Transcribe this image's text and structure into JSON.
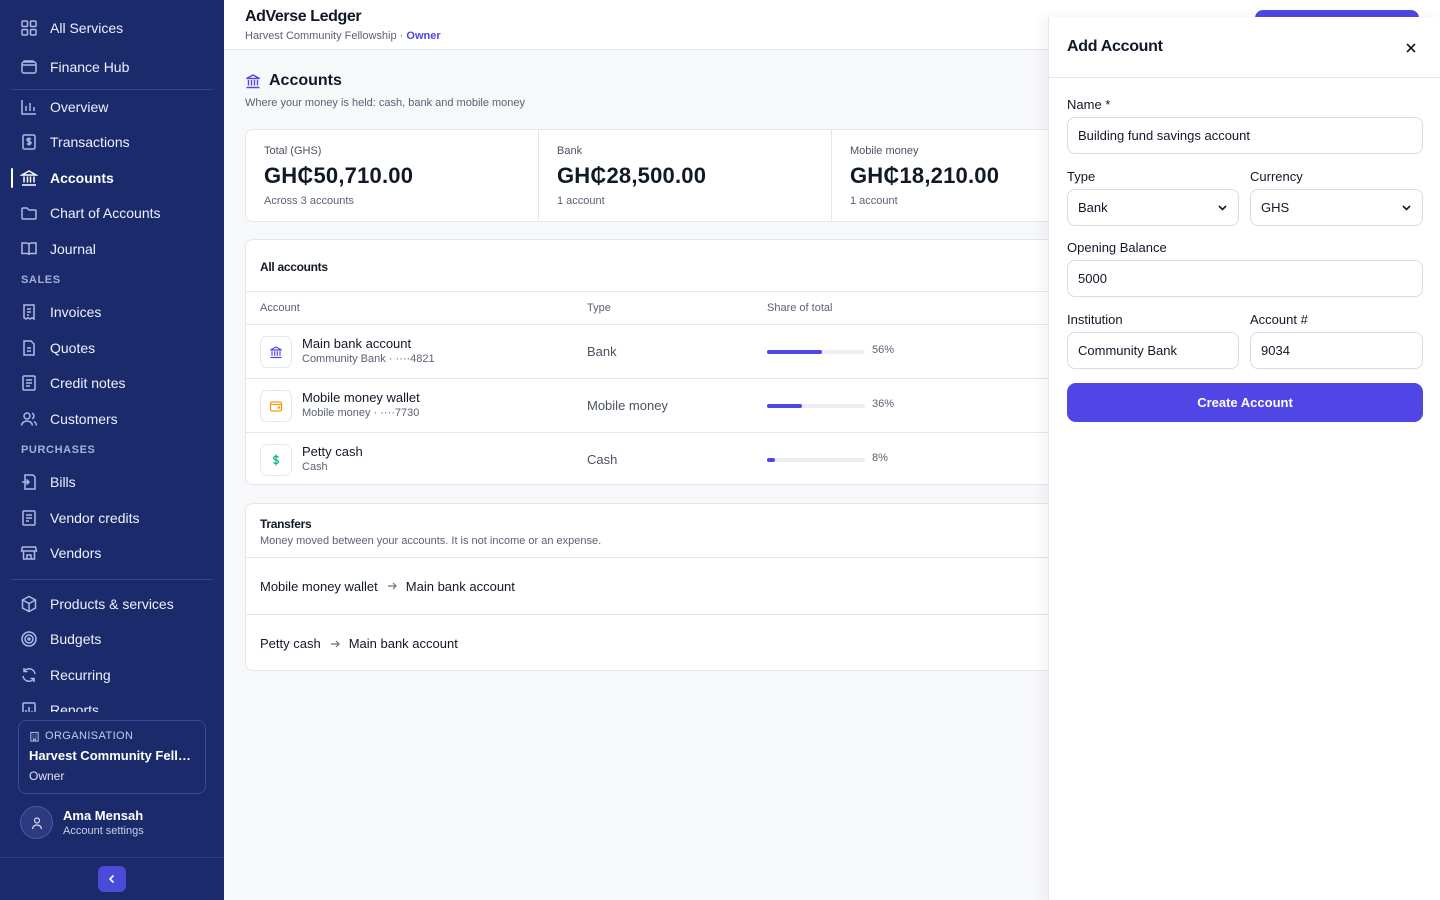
{
  "sidebar": {
    "top_items": [
      {
        "label": "All Services",
        "icon": "grid-icon"
      },
      {
        "label": "Finance Hub",
        "icon": "wallet-icon"
      }
    ],
    "main_items": [
      {
        "label": "Overview",
        "icon": "bar-chart-icon"
      },
      {
        "label": "Transactions",
        "icon": "dollar-doc-icon"
      },
      {
        "label": "Accounts",
        "icon": "bank-icon",
        "active": true
      },
      {
        "label": "Chart of Accounts",
        "icon": "folder-icon"
      },
      {
        "label": "Journal",
        "icon": "book-icon"
      }
    ],
    "sales_title": "SALES",
    "sales_items": [
      {
        "label": "Invoices",
        "icon": "receipt-icon"
      },
      {
        "label": "Quotes",
        "icon": "document-icon"
      },
      {
        "label": "Credit notes",
        "icon": "note-icon"
      },
      {
        "label": "Customers",
        "icon": "users-icon"
      }
    ],
    "purchases_title": "PURCHASES",
    "purchases_items": [
      {
        "label": "Bills",
        "icon": "bill-icon"
      },
      {
        "label": "Vendor credits",
        "icon": "credit-doc-icon"
      },
      {
        "label": "Vendors",
        "icon": "store-icon"
      }
    ],
    "other_items": [
      {
        "label": "Products & services",
        "icon": "box-icon"
      },
      {
        "label": "Budgets",
        "icon": "target-icon"
      },
      {
        "label": "Recurring",
        "icon": "refresh-icon"
      },
      {
        "label": "Reports",
        "icon": "report-icon"
      }
    ],
    "org": {
      "label": "ORGANISATION",
      "name": "Harvest Community Fello...",
      "role": "Owner"
    },
    "user": {
      "name": "Ama Mensah",
      "sub": "Account settings"
    },
    "colors": {
      "background": "#1b2a6b",
      "accent": "#4a4bd8"
    }
  },
  "header": {
    "title": "AdVerse Ledger",
    "org": "Harvest Community Fellowship",
    "separator": " · ",
    "role": "Owner"
  },
  "page": {
    "title": "Accounts",
    "subtitle": "Where your money is held: cash, bank and mobile money"
  },
  "stats": [
    {
      "label": "Total (GHS)",
      "value": "GH₵50,710.00",
      "note": "Across 3 accounts"
    },
    {
      "label": "Bank",
      "value": "GH₵28,500.00",
      "note": "1 account"
    },
    {
      "label": "Mobile money",
      "value": "GH₵18,210.00",
      "note": "1 account"
    }
  ],
  "accounts_table": {
    "title": "All accounts",
    "columns": [
      "Account",
      "Type",
      "Share of total"
    ],
    "rows": [
      {
        "name": "Main bank account",
        "meta": "Community Bank · ····4821",
        "type": "Bank",
        "share": 0.56,
        "share_label": "56%",
        "icon": "bank-icon",
        "icon_color": "#4f46e5"
      },
      {
        "name": "Mobile money wallet",
        "meta": "Mobile money · ····7730",
        "type": "Mobile money",
        "share": 0.36,
        "share_label": "36%",
        "icon": "wallet-icon",
        "icon_color": "#f59e0b"
      },
      {
        "name": "Petty cash",
        "meta": "Cash",
        "type": "Cash",
        "share": 0.08,
        "share_label": "8%",
        "icon": "dollar-icon",
        "icon_color": "#10b981"
      }
    ]
  },
  "transfers": {
    "title": "Transfers",
    "subtitle": "Money moved between your accounts. It is not income or an expense.",
    "rows": [
      {
        "from": "Mobile money wallet",
        "to": "Main bank account"
      },
      {
        "from": "Petty cash",
        "to": "Main bank account"
      }
    ]
  },
  "drawer": {
    "title": "Add Account",
    "name_label": "Name *",
    "name_value": "Building fund savings account",
    "type_label": "Type",
    "type_value": "Bank",
    "currency_label": "Currency",
    "currency_value": "GHS",
    "opening_label": "Opening Balance",
    "opening_value": "5000",
    "institution_label": "Institution",
    "institution_value": "Community Bank",
    "account_no_label": "Account #",
    "account_no_value": "9034",
    "submit_label": "Create Account"
  },
  "colors": {
    "primary": "#4f46e5",
    "page_bg": "#f7f8fa"
  }
}
